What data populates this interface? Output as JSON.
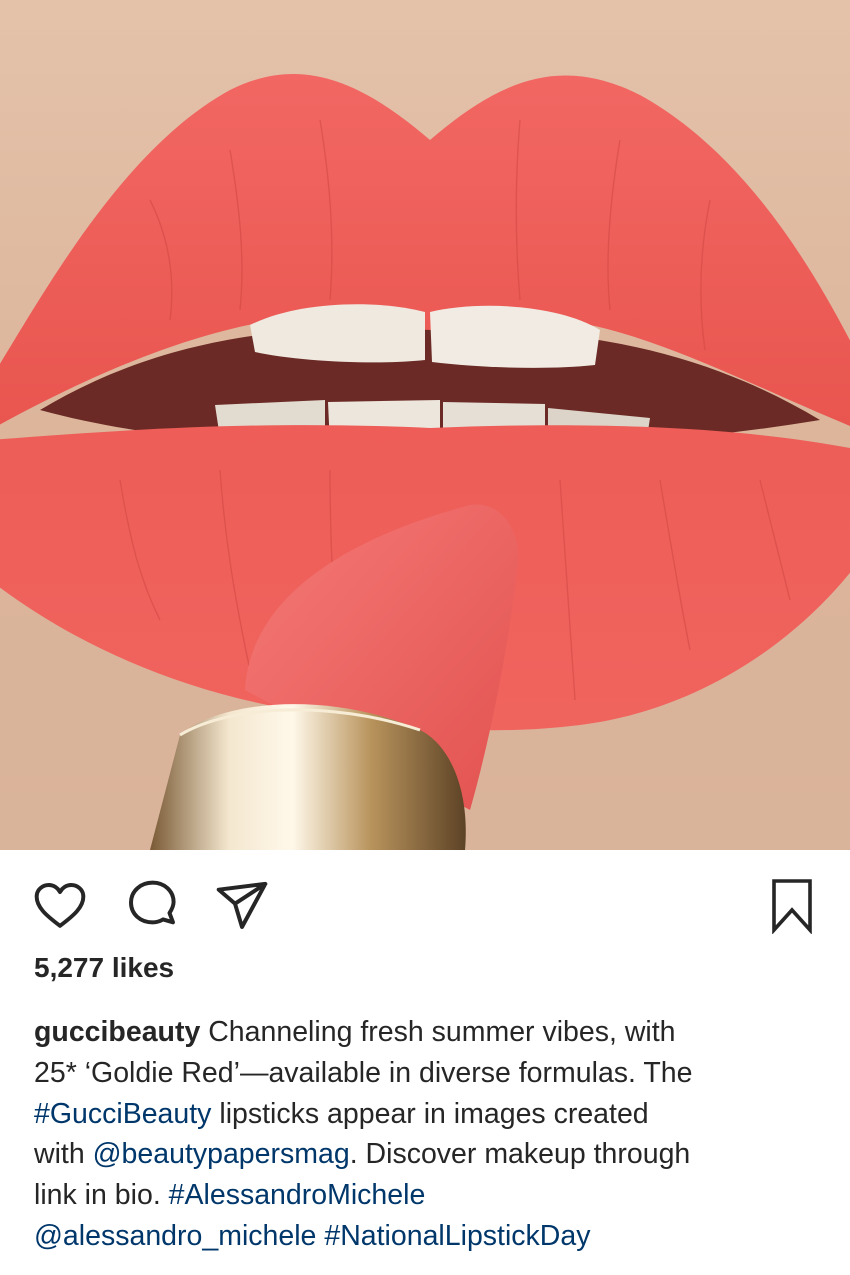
{
  "photo": {
    "alt_icon": "lipstick-photo"
  },
  "actions": {
    "like_icon": "heart-icon",
    "comment_icon": "comment-icon",
    "share_icon": "paper-plane-icon",
    "save_icon": "bookmark-icon"
  },
  "likes": "5,277 likes",
  "caption": {
    "username": "guccibeauty",
    "l1_text": "Channeling fresh summer vibes, with",
    "l2_text": "25* ‘Goldie Red’—available in diverse formulas. The",
    "l3_tag": "#GucciBeauty",
    "l3_text": "lipsticks appear in images created",
    "l4_pre": "with",
    "l4_tag": "@beautypapersmag",
    "l4_text": ". Discover makeup through",
    "l5_text": "link in bio.",
    "l5_tag": "#AlessandroMichele",
    "l6_tag1": "@alessandro_michele",
    "l6_tag2": "#NationalLipstickDay"
  },
  "colors": {
    "link": "#00376b",
    "text": "#262626",
    "lip": "#f0605d"
  }
}
